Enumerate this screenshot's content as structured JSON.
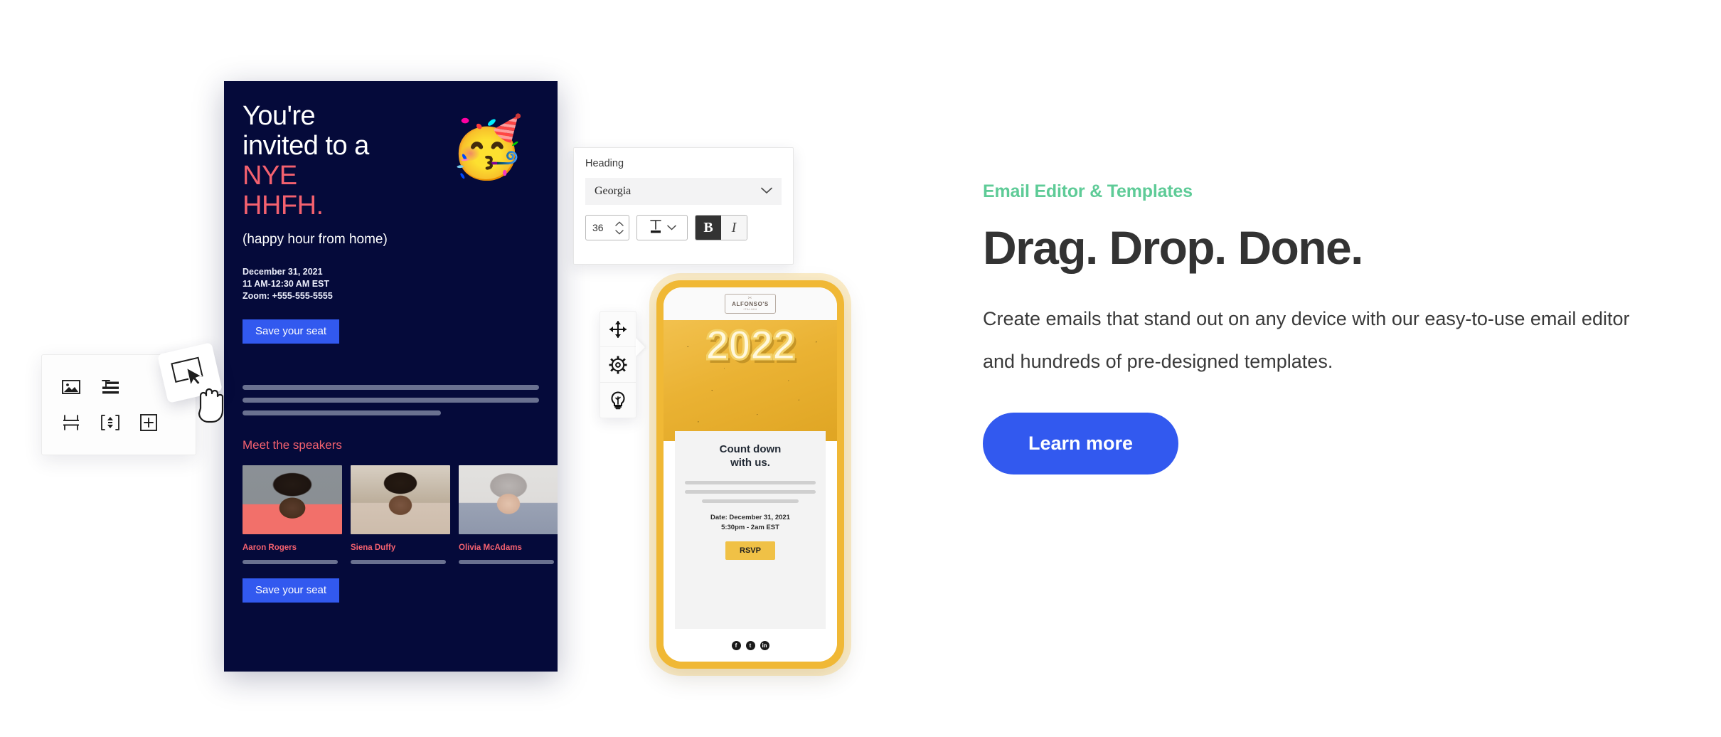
{
  "colors": {
    "accent_green": "#5ecb97",
    "brand_blue": "#3259ef",
    "email_bg": "#050a3a",
    "email_accent_red": "#f4616f",
    "phone_yellow": "#f0b835",
    "headline_dark": "#333333"
  },
  "feature": {
    "eyebrow": "Email Editor & Templates",
    "headline": "Drag. Drop. Done.",
    "body": "Create emails that stand out on any device with our easy-to-use email editor and hundreds of pre-designed templates.",
    "cta_label": "Learn more"
  },
  "email_preview": {
    "heading_line1": "You're",
    "heading_line2": "invited to a",
    "heading_accent1": "NYE",
    "heading_accent2": "HHFH",
    "heading_period": ".",
    "subheading": "(happy hour from home)",
    "meta": {
      "date": "December 31, 2021",
      "time": "11 AM-12:30 AM EST",
      "zoom": "Zoom: +555-555-5555"
    },
    "cta_top": "Save your seat",
    "cta_bottom": "Save your seat",
    "emoji": "🥳",
    "speakers_title": "Meet the speakers",
    "speakers": [
      {
        "name": "Aaron Rogers"
      },
      {
        "name": "Siena Duffy"
      },
      {
        "name": "Olivia McAdams"
      }
    ]
  },
  "heading_toolbar": {
    "label": "Heading",
    "font_family_value": "Georgia",
    "font_size_value": "36",
    "text_color_icon": "text-color-icon",
    "bold_label": "B",
    "italic_label": "I",
    "bold_active": true,
    "italic_active": false,
    "dropdown_icon": "chevron-down-icon",
    "stepper_up_icon": "chevron-up-icon",
    "stepper_down_icon": "chevron-down-icon"
  },
  "blocks_panel": {
    "items": [
      {
        "icon": "image-block-icon"
      },
      {
        "icon": "text-block-icon"
      },
      {
        "icon": "divider-block-icon"
      },
      {
        "icon": "spacer-block-icon"
      },
      {
        "icon": "add-block-icon"
      }
    ],
    "drag_badge_icon": "drag-element-icon",
    "cursor_icon": "grab-hand-cursor-icon"
  },
  "tool_rail": {
    "items": [
      {
        "icon": "move-icon"
      },
      {
        "icon": "gear-icon"
      },
      {
        "icon": "lightbulb-icon"
      }
    ]
  },
  "phone_preview": {
    "logo": {
      "cut": "✂",
      "name": "ALFONSO'S",
      "sub": "ITALIAN"
    },
    "year": "2022",
    "title_line1": "Count down",
    "title_line2": "with us.",
    "date_line1": "Date: December 31, 2021",
    "date_line2": "5:30pm - 2am EST",
    "rsvp_label": "RSVP",
    "social": [
      {
        "icon": "facebook-icon",
        "glyph": "f"
      },
      {
        "icon": "twitter-icon",
        "glyph": "t"
      },
      {
        "icon": "linkedin-icon",
        "glyph": "in"
      }
    ]
  }
}
